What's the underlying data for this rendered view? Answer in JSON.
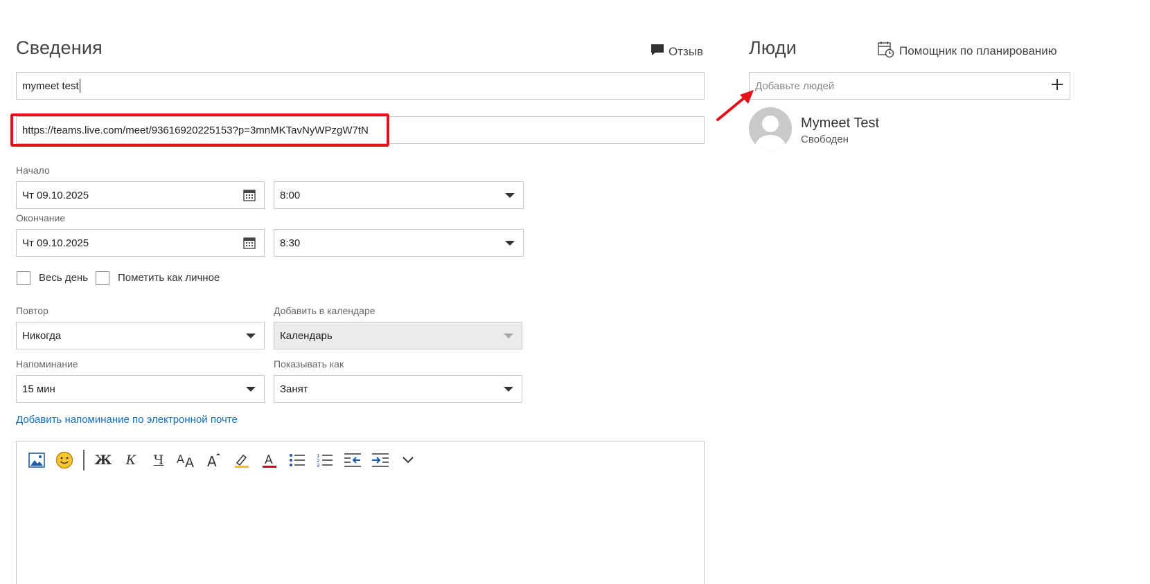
{
  "details": {
    "title": "Сведения",
    "feedback_label": "Отзыв",
    "subject_value": "mymeet test",
    "location_value": "https://teams.live.com/meet/93616920225153?p=3mnMKTavNyWPzgW7tN",
    "start_label": "Начало",
    "start_date": "Чт 09.10.2025",
    "start_time": "8:00",
    "end_label": "Окончание",
    "end_date": "Чт 09.10.2025",
    "end_time": "8:30",
    "all_day_label": "Весь день",
    "private_label": "Пометить как личное",
    "repeat_label": "Повтор",
    "repeat_value": "Никогда",
    "calendar_label": "Добавить в календаре",
    "calendar_value": "Календарь",
    "reminder_label": "Напоминание",
    "reminder_value": "15 мин",
    "show_as_label": "Показывать как",
    "show_as_value": "Занят",
    "email_reminder_link": "Добавить напоминание по электронной почте"
  },
  "toolbar": {
    "icons": [
      "insert-picture-icon",
      "emoji-icon",
      "bold-icon",
      "italic-icon",
      "underline-icon",
      "font-size-icon",
      "grow-font-icon",
      "highlight-icon",
      "font-color-icon",
      "bullets-icon",
      "numbering-icon",
      "decrease-indent-icon",
      "increase-indent-icon",
      "more-options-icon"
    ]
  },
  "people": {
    "title": "Люди",
    "scheduling_label": "Помощник по планированию",
    "add_people_placeholder": "Добавьте людей",
    "attendee_name": "Mymeet Test",
    "attendee_status": "Свободен"
  },
  "colors": {
    "highlight_box": "#e3101a",
    "arrow": "#e3101a",
    "link": "#0f6cbd",
    "border": "#c8c8c8",
    "disabled_bg": "#ebebeb"
  }
}
